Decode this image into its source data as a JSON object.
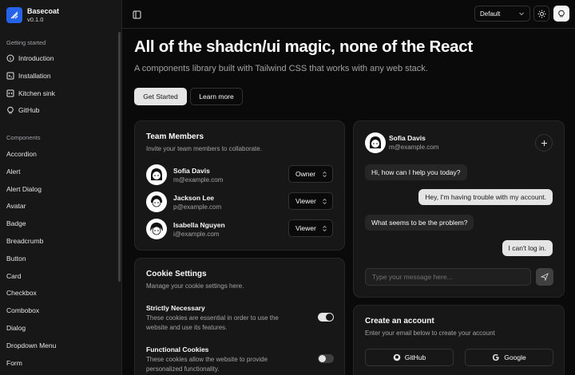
{
  "brand": {
    "name": "Basecoat",
    "version": "v0.1.0"
  },
  "sidebar": {
    "section1_label": "Getting started",
    "getting_started": [
      {
        "label": "Introduction",
        "icon": "circle-info-icon"
      },
      {
        "label": "Installation",
        "icon": "terminal-icon"
      },
      {
        "label": "Kitchen sink",
        "icon": "code-icon"
      },
      {
        "label": "GitHub",
        "icon": "github-icon"
      }
    ],
    "section2_label": "Components",
    "components": [
      "Accordion",
      "Alert",
      "Alert Dialog",
      "Avatar",
      "Badge",
      "Breadcrumb",
      "Button",
      "Card",
      "Checkbox",
      "Combobox",
      "Dialog",
      "Dropdown Menu",
      "Form"
    ]
  },
  "topbar": {
    "theme_select": "Default"
  },
  "hero": {
    "title": "All of the shadcn/ui magic, none of the React",
    "subtitle": "A components library built with Tailwind CSS that works with any web stack.",
    "primary_button": "Get Started",
    "secondary_button": "Learn more"
  },
  "team": {
    "title": "Team Members",
    "description": "Invite your team members to collaborate.",
    "members": [
      {
        "name": "Sofia Davis",
        "email": "m@example.com",
        "role": "Owner"
      },
      {
        "name": "Jackson Lee",
        "email": "p@example.com",
        "role": "Viewer"
      },
      {
        "name": "Isabella Nguyen",
        "email": "i@example.com",
        "role": "Viewer"
      }
    ]
  },
  "cookies": {
    "title": "Cookie Settings",
    "description": "Manage your cookie settings here.",
    "items": [
      {
        "title": "Strictly Necessary",
        "description": "These cookies are essential in order to use the website and use its features.",
        "enabled": true
      },
      {
        "title": "Functional Cookies",
        "description": "These cookies allow the website to provide personalized functionality.",
        "enabled": false
      }
    ]
  },
  "chat": {
    "name": "Sofia Davis",
    "email": "m@example.com",
    "messages": [
      {
        "text": "Hi, how can I help you today?",
        "from": "agent"
      },
      {
        "text": "Hey, I'm having trouble with my account.",
        "from": "user"
      },
      {
        "text": "What seems to be the problem?",
        "from": "agent"
      },
      {
        "text": "I can't log in.",
        "from": "user"
      }
    ],
    "input_placeholder": "Type your message here..."
  },
  "account": {
    "title": "Create an account",
    "description": "Enter your email below to create your account",
    "github_label": "GitHub",
    "google_label": "Google"
  },
  "colors": {
    "accent": "#2563eb",
    "background": "#0a0a0a",
    "card": "#171717",
    "border": "#262626"
  }
}
